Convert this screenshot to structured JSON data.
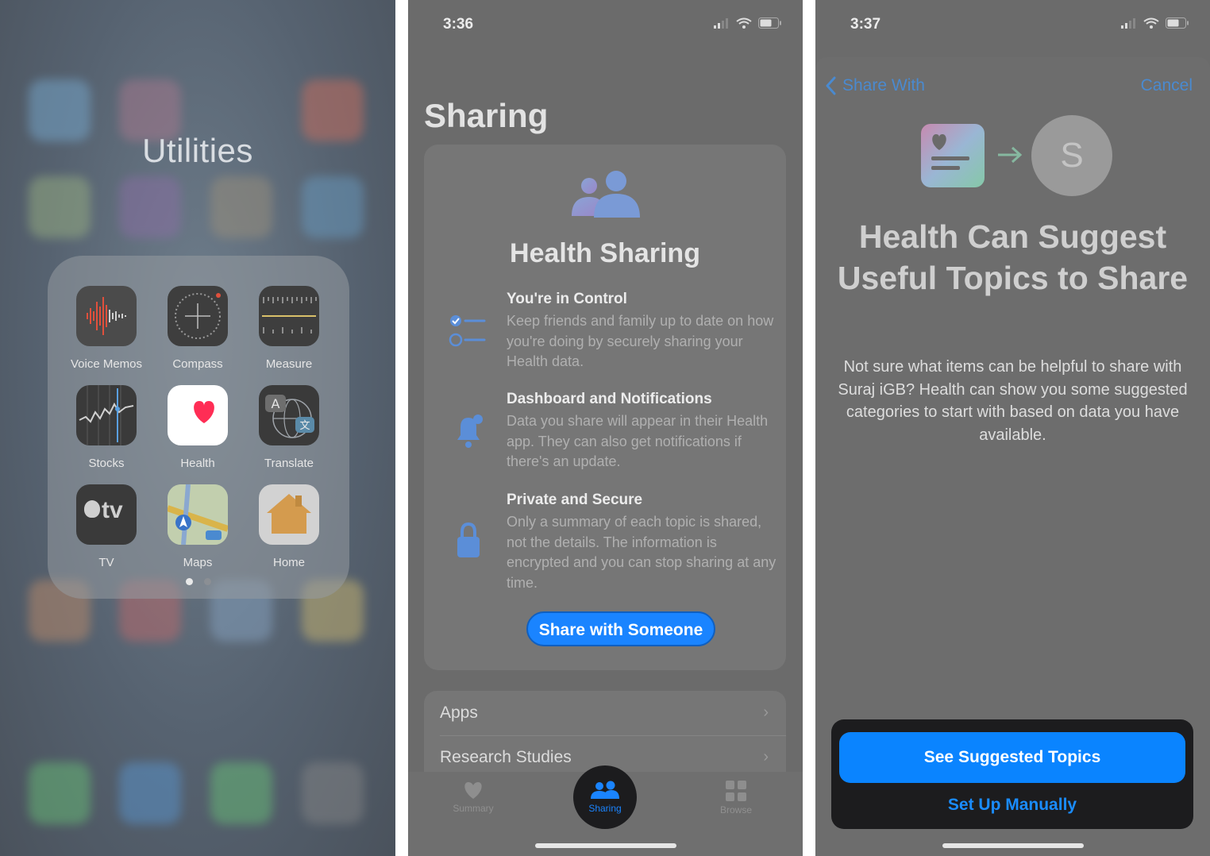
{
  "panel1": {
    "folder_title": "Utilities",
    "apps": [
      {
        "label": "Voice Memos"
      },
      {
        "label": "Compass"
      },
      {
        "label": "Measure"
      },
      {
        "label": "Stocks"
      },
      {
        "label": "Health"
      },
      {
        "label": "Translate"
      },
      {
        "label": "TV"
      },
      {
        "label": "Maps"
      },
      {
        "label": "Home"
      }
    ],
    "tv_logo_text": "tv",
    "page_count": 2,
    "current_page": 1
  },
  "panel2": {
    "time": "3:36",
    "title": "Sharing",
    "card_title": "Health Sharing",
    "features": [
      {
        "title": "You're in Control",
        "desc": "Keep friends and family up to date on how you're doing by securely sharing your Health data."
      },
      {
        "title": "Dashboard and Notifications",
        "desc": "Data you share will appear in their Health app. They can also get notifications if there's an update."
      },
      {
        "title": "Private and Secure",
        "desc": "Only a summary of each topic is shared, not the details. The information is encrypted and you can stop sharing at any time."
      }
    ],
    "share_button": "Share with Someone",
    "list": [
      {
        "label": "Apps"
      },
      {
        "label": "Research Studies"
      }
    ],
    "tabs": [
      {
        "label": "Summary",
        "icon": "heart-icon"
      },
      {
        "label": "Sharing",
        "icon": "people-icon"
      },
      {
        "label": "Browse",
        "icon": "grid-icon"
      }
    ],
    "accent": "#1a84ff"
  },
  "panel3": {
    "time": "3:37",
    "back_label": "Share With",
    "cancel_label": "Cancel",
    "avatar_letter": "S",
    "title": "Health Can Suggest Useful Topics to Share",
    "body": "Not sure what items can be helpful to share with Suraj iGB? Health can show you some suggested categories to start with based on data you have available.",
    "primary_button": "See Suggested Topics",
    "secondary_button": "Set Up Manually",
    "accent": "#0a84ff"
  }
}
